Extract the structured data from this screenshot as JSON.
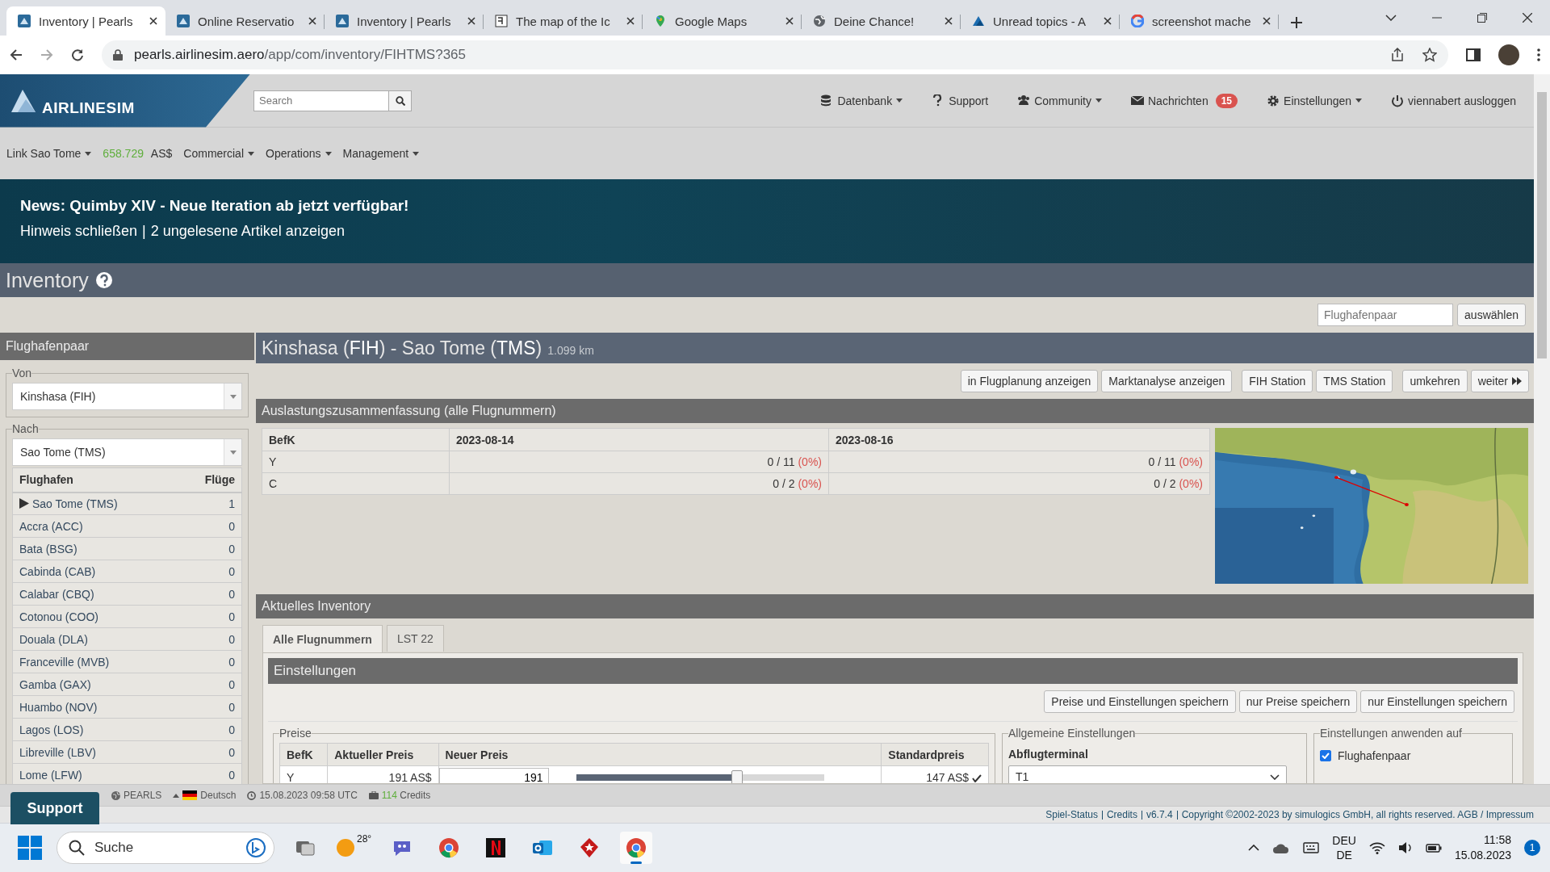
{
  "browser": {
    "tabs": [
      {
        "title": "Inventory | Pearls",
        "selected": true
      },
      {
        "title": "Online Reservatio",
        "selected": false
      },
      {
        "title": "Inventory | Pearls",
        "selected": false
      },
      {
        "title": "The map of the Ic",
        "selected": false
      },
      {
        "title": "Google Maps",
        "selected": false
      },
      {
        "title": "Deine Chance!",
        "selected": false
      },
      {
        "title": "Unread topics - A",
        "selected": false
      },
      {
        "title": "screenshot mache",
        "selected": false
      }
    ],
    "address": {
      "host": "pearls.airlinesim.aero",
      "path": "/app/com/inventory/FIHTMS?365"
    }
  },
  "header": {
    "logo": "AIRLINESIM",
    "search": {
      "placeholder": "Search"
    },
    "menu": [
      {
        "label": "Datenbank",
        "dropdown": true
      },
      {
        "label": "Support",
        "dropdown": false
      },
      {
        "label": "Community",
        "dropdown": true
      },
      {
        "label": "Nachrichten",
        "dropdown": false,
        "badge": "15"
      },
      {
        "label": "Einstellungen",
        "dropdown": true
      },
      {
        "label": "viennabert ausloggen",
        "dropdown": false
      }
    ]
  },
  "subnav": {
    "airline": "Link Sao Tome",
    "balance": "658.729",
    "currency": "AS$",
    "menus": [
      "Commercial",
      "Operations",
      "Management"
    ]
  },
  "news": {
    "headline": "News: Quimby XIV - Neue Iteration ab jetzt verfügbar!",
    "links": [
      "Hinweis schließen",
      "2 ungelesene Artikel anzeigen"
    ],
    "separator": "|"
  },
  "page": {
    "title": "Inventory",
    "pair_search": {
      "placeholder": "Flughafenpaar"
    },
    "pair_button": "auswählen"
  },
  "sidebar": {
    "title": "Flughafenpaar",
    "from": {
      "legend": "Von",
      "value": "Kinshasa (FIH)"
    },
    "to": {
      "legend": "Nach",
      "value": "Sao Tome (TMS)"
    },
    "columns": [
      "Flughafen",
      "Flüge"
    ],
    "rows": [
      {
        "name": "Sao Tome (TMS)",
        "flights": "1",
        "selected": true
      },
      {
        "name": "Accra (ACC)",
        "flights": "0",
        "selected": false
      },
      {
        "name": "Bata (BSG)",
        "flights": "0",
        "selected": false
      },
      {
        "name": "Cabinda (CAB)",
        "flights": "0",
        "selected": false
      },
      {
        "name": "Calabar (CBQ)",
        "flights": "0",
        "selected": false
      },
      {
        "name": "Cotonou (COO)",
        "flights": "0",
        "selected": false
      },
      {
        "name": "Douala (DLA)",
        "flights": "0",
        "selected": false
      },
      {
        "name": "Franceville (MVB)",
        "flights": "0",
        "selected": false
      },
      {
        "name": "Gamba (GAX)",
        "flights": "0",
        "selected": false
      },
      {
        "name": "Huambo (NOV)",
        "flights": "0",
        "selected": false
      },
      {
        "name": "Lagos (LOS)",
        "flights": "0",
        "selected": false
      },
      {
        "name": "Libreville (LBV)",
        "flights": "0",
        "selected": false
      },
      {
        "name": "Lome (LFW)",
        "flights": "0",
        "selected": false
      }
    ]
  },
  "route": {
    "title": "Kinshasa (**FIH**) - Sao Tome (**TMS**)",
    "distance": "1.099 km",
    "action_groups": [
      [
        "in Flugplanung anzeigen",
        "Marktanalyse anzeigen"
      ],
      [
        "FIH Station",
        "TMS Station"
      ],
      [
        "umkehren",
        "weiter"
      ]
    ]
  },
  "load_summary": {
    "title": "Auslastungszusammenfassung (alle Flugnummern)",
    "columns": [
      "BefK",
      "2023-08-14",
      "2023-08-16"
    ],
    "rows": [
      {
        "cells": [
          {
            "count": "Y"
          },
          {
            "count": "0 / 11",
            "percent": "(0%)"
          },
          {
            "count": "0 / 11",
            "percent": "(0%)"
          }
        ]
      },
      {
        "cells": [
          {
            "count": "C"
          },
          {
            "count": "0 / 2",
            "percent": "(0%)"
          },
          {
            "count": "0 / 2",
            "percent": "(0%)"
          }
        ]
      }
    ],
    "map": {
      "kind": "picture"
    }
  },
  "inventory": {
    "title": "Aktuelles Inventory",
    "tabs": [
      {
        "label": "Alle Flugnummern",
        "selected": true
      },
      {
        "label": "LST 22",
        "selected": false
      }
    ],
    "settings_title": "Einstellungen",
    "buttons": [
      "Preise und Einstellungen speichern",
      "nur Preise speichern",
      "nur Einstellungen speichern"
    ],
    "prices": {
      "legend": "Preise",
      "columns": [
        "BefK",
        "Aktueller Preis",
        "Neuer Preis",
        "Standardpreis"
      ],
      "rows": [
        {
          "class": "Y",
          "current": "191 AS$",
          "new": "191",
          "level": 0.65,
          "standard": "147 AS$"
        }
      ]
    },
    "general": {
      "legend": "Allgemeine Einstellungen",
      "label": "Abflugterminal",
      "value": "T1"
    },
    "apply": {
      "legend": "Einstellungen anwenden auf",
      "options": [
        {
          "label": "Flughafenpaar",
          "checked": true
        }
      ]
    }
  },
  "status_bar": {
    "support": "Support",
    "server": "PEARLS",
    "language": "Deutsch",
    "time": "15.08.2023 09:58 UTC",
    "credits": "114",
    "credits_label": "Credits"
  },
  "footer": {
    "items": [
      "Spiel-Status",
      "Credits",
      "v6.7.4",
      "Copyright ©2002-2023 by simulogics GmbH, all rights reserved. AGB / Impressum"
    ]
  },
  "taskbar": {
    "search": {
      "placeholder": "Suche"
    },
    "weather": "28°",
    "language": [
      "DEU",
      "DE"
    ],
    "time": "11:58",
    "date": "15.08.2023",
    "notifications": "1"
  }
}
